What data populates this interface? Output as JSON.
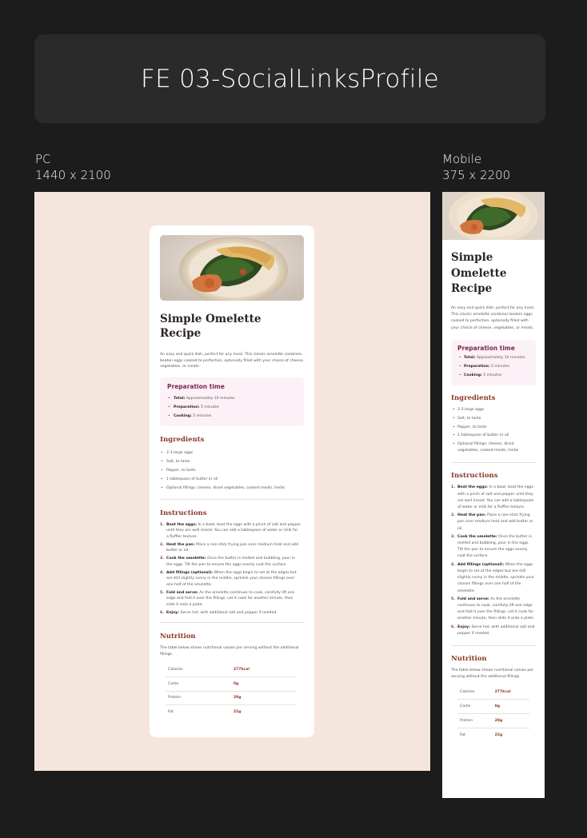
{
  "header": {
    "title": "FE 03-SocialLinksProfile"
  },
  "frames": {
    "pc": {
      "name": "PC",
      "size": "1440 x 2100"
    },
    "mobile": {
      "name": "Mobile",
      "size": "375 x 2200"
    }
  },
  "recipe": {
    "title": "Simple Omelette Recipe",
    "title_lines": [
      "Simple",
      "Omelette",
      "Recipe"
    ],
    "intro": "An easy and quick dish, perfect for any meal. This classic omelette combines beaten eggs cooked to perfection, optionally filled with your choice of cheese, vegetables, or meats.",
    "prep": {
      "title": "Preparation time",
      "items": [
        {
          "key": "Total:",
          "text": "Approximately 10 minutes"
        },
        {
          "key": "Preparation:",
          "text": "5 minutes"
        },
        {
          "key": "Cooking:",
          "text": "5 minutes"
        }
      ]
    },
    "ingredients": {
      "title": "Ingredients",
      "items": [
        "2-3 large eggs",
        "Salt, to taste",
        "Pepper, to taste",
        "1 tablespoon of butter or oil",
        "Optional fillings: cheese, diced vegetables, cooked meats, herbs"
      ]
    },
    "instructions": {
      "title": "Instructions",
      "items": [
        {
          "num": "1.",
          "key": "Beat the eggs:",
          "text": "In a bowl, beat the eggs with a pinch of salt and pepper until they are well mixed. You can add a tablespoon of water or milk for a fluffier texture."
        },
        {
          "num": "2.",
          "key": "Heat the pan:",
          "text": "Place a non-stick frying pan over medium heat and add butter or oil."
        },
        {
          "num": "3.",
          "key": "Cook the omelette:",
          "text": "Once the butter is melted and bubbling, pour in the eggs. Tilt the pan to ensure the eggs evenly coat the surface."
        },
        {
          "num": "4.",
          "key": "Add fillings (optional):",
          "text": "When the eggs begin to set at the edges but are still slightly runny in the middle, sprinkle your chosen fillings over one half of the omelette."
        },
        {
          "num": "5.",
          "key": "Fold and serve:",
          "text": "As the omelette continues to cook, carefully lift one edge and fold it over the fillings. Let it cook for another minute, then slide it onto a plate."
        },
        {
          "num": "6.",
          "key": "Enjoy:",
          "text": "Serve hot, with additional salt and pepper if needed."
        }
      ]
    },
    "nutrition": {
      "title": "Nutrition",
      "note": "The table below shows nutritional values per serving without the additional fillings.",
      "rows": [
        {
          "label": "Calories",
          "value": "277kcal"
        },
        {
          "label": "Carbs",
          "value": "0g"
        },
        {
          "label": "Protein",
          "value": "20g"
        },
        {
          "label": "Fat",
          "value": "22g"
        }
      ]
    }
  },
  "colors": {
    "page_bg": "#1c1c1c",
    "pc_bg": "#f4e6dc",
    "accent_rose": "#7a2950",
    "accent_brown": "#8a3a25",
    "prep_bg": "#fcf1f6"
  },
  "icons": {
    "hero": "omelette-photo"
  }
}
